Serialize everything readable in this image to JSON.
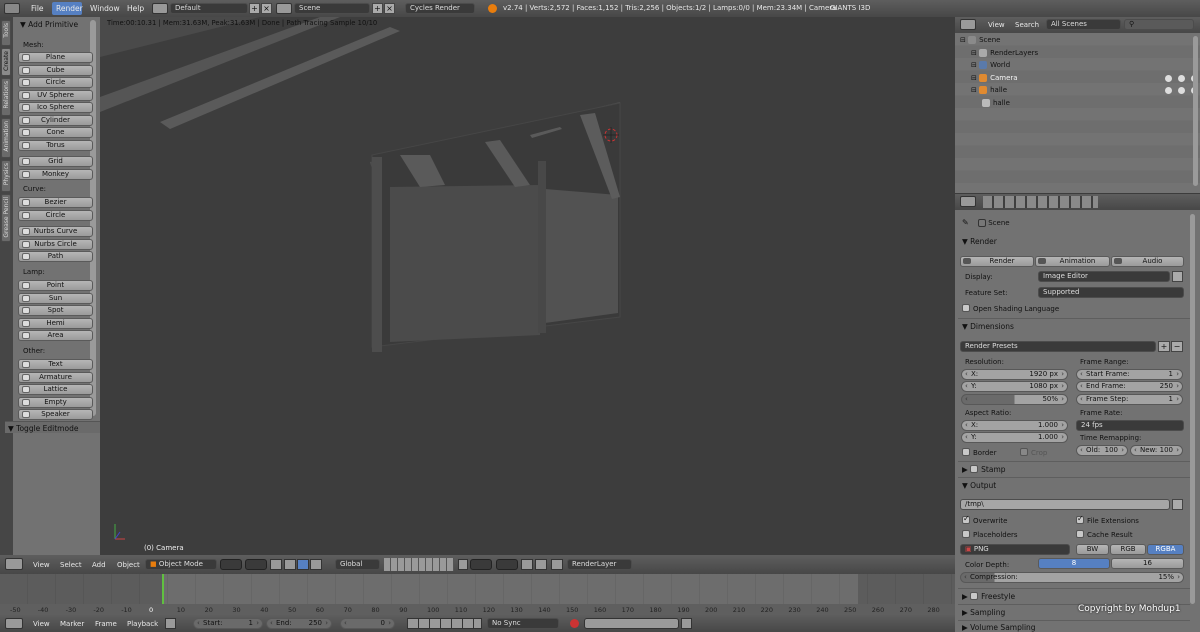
{
  "menubar": {
    "items": [
      "File",
      "Render",
      "Window",
      "Help"
    ],
    "layout": "Default",
    "scene": "Scene",
    "engine": "Cycles Render",
    "stats": "v2.74 | Verts:2,572 | Faces:1,152 | Tris:2,256 | Objects:1/2 | Lamps:0/0 | Mem:23.34M | Camera",
    "plugin": "GIANTS I3D"
  },
  "toolshelf": {
    "tabs": [
      "Tools",
      "Create",
      "Relations",
      "Animation",
      "Physics",
      "Grease Pencil"
    ],
    "header": "Add Primitive",
    "sections": [
      {
        "title": "Mesh:",
        "items": [
          "Plane",
          "Cube",
          "Circle",
          "UV Sphere",
          "Ico Sphere",
          "Cylinder",
          "Cone",
          "Torus"
        ]
      },
      {
        "title": "",
        "items": [
          "Grid",
          "Monkey"
        ]
      },
      {
        "title": "Curve:",
        "items": [
          "Bezier",
          "Circle"
        ]
      },
      {
        "title": "",
        "items": [
          "Nurbs Curve",
          "Nurbs Circle",
          "Path"
        ]
      },
      {
        "title": "Lamp:",
        "items": [
          "Point",
          "Sun",
          "Spot",
          "Hemi",
          "Area"
        ]
      },
      {
        "title": "Other:",
        "items": [
          "Text",
          "Armature",
          "Lattice",
          "Empty",
          "Speaker"
        ]
      }
    ],
    "toggle": "Toggle Editmode"
  },
  "viewport": {
    "info": "Time:00:10.31 | Mem:31.63M, Peak:31.63M | Done | Path Tracing Sample 10/10",
    "camera_label": "(0) Camera",
    "header": {
      "menus": [
        "View",
        "Select",
        "Add",
        "Object"
      ],
      "mode": "Object Mode",
      "orientation": "Global",
      "renderlayer": "RenderLayer"
    }
  },
  "outliner": {
    "menus": [
      "View",
      "Search"
    ],
    "filter": "All Scenes",
    "tree": [
      {
        "label": "Scene",
        "indent": 0
      },
      {
        "label": "RenderLayers",
        "indent": 1
      },
      {
        "label": "World",
        "indent": 1
      },
      {
        "label": "Camera",
        "indent": 1
      },
      {
        "label": "halle",
        "indent": 1
      },
      {
        "label": "halle",
        "indent": 2
      }
    ]
  },
  "properties": {
    "context": "Scene",
    "render": {
      "title": "Render",
      "buttons": [
        "Render",
        "Animation",
        "Audio"
      ],
      "display_label": "Display:",
      "display": "Image Editor",
      "feature_label": "Feature Set:",
      "feature": "Supported",
      "osl": "Open Shading Language"
    },
    "dimensions": {
      "title": "Dimensions",
      "presets": "Render Presets",
      "resolution_label": "Resolution:",
      "res_x_label": "X:",
      "res_x": "1920 px",
      "res_y_label": "Y:",
      "res_y": "1080 px",
      "res_pct": "50%",
      "frame_range_label": "Frame Range:",
      "start_label": "Start Frame:",
      "start": "1",
      "end_label": "End Frame:",
      "end": "250",
      "step_label": "Frame Step:",
      "step": "1",
      "aspect_label": "Aspect Ratio:",
      "asp_x_label": "X:",
      "asp_x": "1.000",
      "asp_y_label": "Y:",
      "asp_y": "1.000",
      "frame_rate_label": "Frame Rate:",
      "fps": "24 fps",
      "remap_label": "Time Remapping:",
      "old_label": "Old:",
      "old": "100",
      "new_label": "New:",
      "new": "100",
      "border": "Border",
      "crop": "Crop"
    },
    "stamp": "Stamp",
    "output": {
      "title": "Output",
      "path": "/tmp\\",
      "overwrite": "Overwrite",
      "file_ext": "File Extensions",
      "placeholders": "Placeholders",
      "cache": "Cache Result",
      "format": "PNG",
      "modes": [
        "BW",
        "RGB",
        "RGBA"
      ],
      "depth_label": "Color Depth:",
      "depths": [
        "8",
        "16"
      ],
      "compression_label": "Compression:",
      "compression": "15%"
    },
    "freestyle": "Freestyle",
    "sampling": "Sampling",
    "volume": "Volume Sampling",
    "copyright": "Copyright by Mohdup1"
  },
  "timeline": {
    "ticks": [
      "-50",
      "-40",
      "-30",
      "-20",
      "-10",
      "0",
      "10",
      "20",
      "30",
      "40",
      "50",
      "60",
      "70",
      "80",
      "90",
      "100",
      "110",
      "120",
      "130",
      "140",
      "150",
      "160",
      "170",
      "180",
      "190",
      "200",
      "210",
      "220",
      "230",
      "240",
      "250",
      "260",
      "270",
      "280"
    ],
    "menus": [
      "View",
      "Marker",
      "Frame",
      "Playback"
    ],
    "start_label": "Start:",
    "start": "1",
    "end_label": "End:",
    "end": "250",
    "current": "0",
    "sync": "No Sync"
  },
  "colors": {
    "accent": "#5680c2",
    "header": "#4f4f4f",
    "panel": "#727272"
  }
}
